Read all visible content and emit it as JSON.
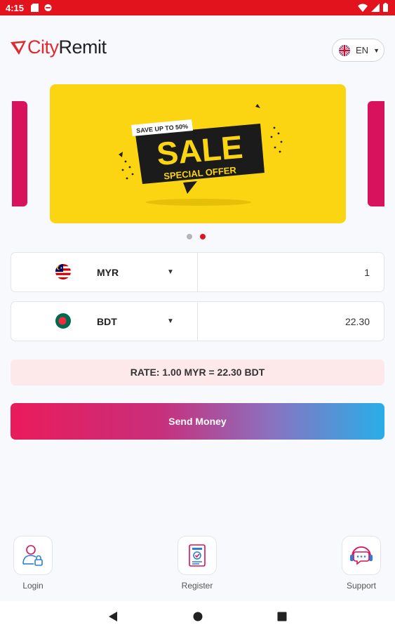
{
  "status_bar": {
    "time": "4:15"
  },
  "header": {
    "logo_city": "City",
    "logo_remit": "Remit",
    "language": "EN"
  },
  "banner": {
    "badge": "SAVE UP TO 50%",
    "headline": "SALE",
    "subline": "SPECIAL OFFER",
    "background": "#fbd511",
    "pager_count": 2,
    "pager_active": 2
  },
  "converter": {
    "from": {
      "currency": "MYR",
      "amount": "1",
      "flag": "malaysia-flag-icon"
    },
    "to": {
      "currency": "BDT",
      "amount": "22.30",
      "flag": "bangladesh-flag-icon"
    },
    "rate_text": "RATE: 1.00 MYR = 22.30 BDT"
  },
  "actions": {
    "send_label": "Send Money"
  },
  "bottom_nav": {
    "login": "Login",
    "register": "Register",
    "support": "Support"
  },
  "colors": {
    "brand_red": "#e3131e",
    "accent_pink": "#ea1b5a",
    "accent_blue": "#28aee8",
    "rate_bg": "#fde9ea"
  }
}
